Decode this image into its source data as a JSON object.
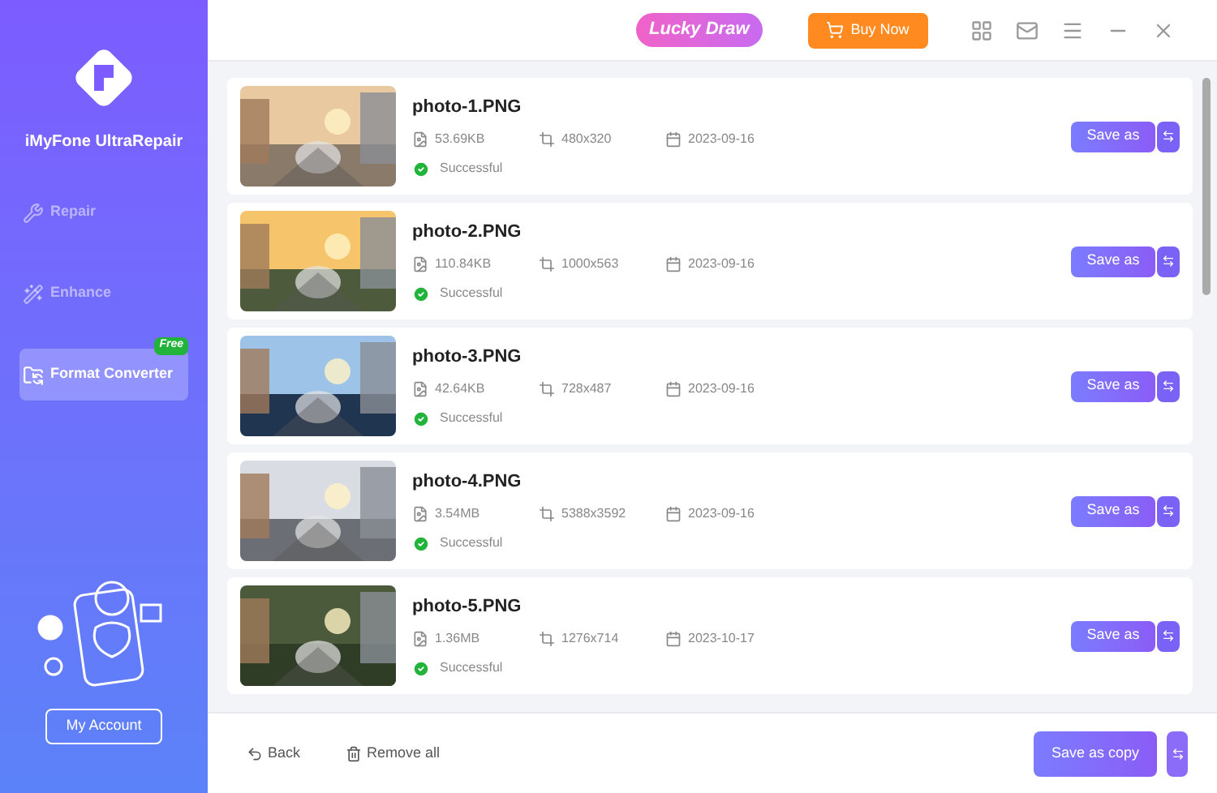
{
  "sidebar": {
    "app_name": "iMyFone UltraRepair",
    "items": [
      {
        "label": "Repair",
        "selected": false
      },
      {
        "label": "Enhance",
        "selected": false
      },
      {
        "label": "Format Converter",
        "selected": true,
        "badge": "Free"
      }
    ],
    "account_button": "My Account"
  },
  "header": {
    "promo": "Lucky Draw",
    "buy_button": "Buy Now"
  },
  "files": [
    {
      "name": "photo-1.PNG",
      "size": "53.69KB",
      "dimensions": "480x320",
      "date": "2023-09-16",
      "status": "Successful",
      "save_button": "Save as"
    },
    {
      "name": "photo-2.PNG",
      "size": "110.84KB",
      "dimensions": "1000x563",
      "date": "2023-09-16",
      "status": "Successful",
      "save_button": "Save as"
    },
    {
      "name": "photo-3.PNG",
      "size": "42.64KB",
      "dimensions": "728x487",
      "date": "2023-09-16",
      "status": "Successful",
      "save_button": "Save as"
    },
    {
      "name": "photo-4.PNG",
      "size": "3.54MB",
      "dimensions": "5388x3592",
      "date": "2023-09-16",
      "status": "Successful",
      "save_button": "Save as"
    },
    {
      "name": "photo-5.PNG",
      "size": "1.36MB",
      "dimensions": "1276x714",
      "date": "2023-10-17",
      "status": "Successful",
      "save_button": "Save as"
    }
  ],
  "footer": {
    "back": "Back",
    "remove_all": "Remove all",
    "save_copy": "Save as copy"
  }
}
